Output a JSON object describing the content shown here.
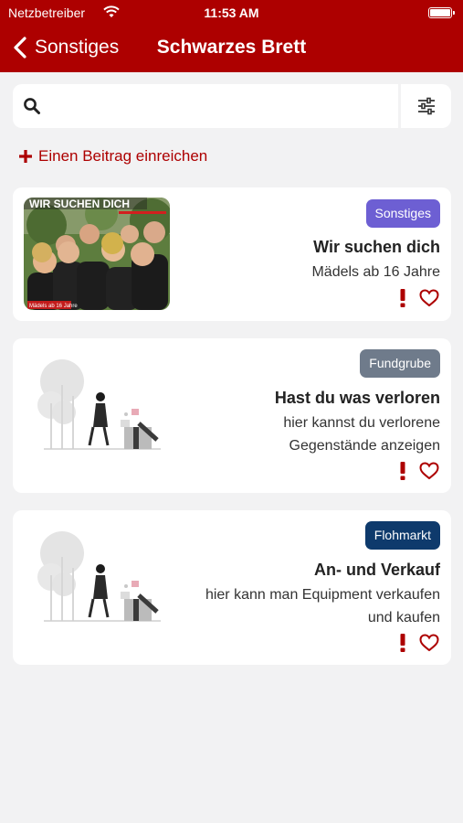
{
  "status_bar": {
    "carrier": "Netzbetreiber",
    "time": "11:53 AM"
  },
  "nav": {
    "back_label": "Sonstiges",
    "title": "Schwarzes Brett"
  },
  "search": {
    "placeholder": "",
    "value": ""
  },
  "add_post_label": "Einen Beitrag einreichen",
  "theme": {
    "brand": "#ad0000",
    "background": "#f2f2f3"
  },
  "cards": [
    {
      "badge": "Sonstiges",
      "badge_color": "#6d5fd3",
      "title": "Wir suchen dich",
      "subtitle": [
        "Mädels ab 16 Jahre"
      ],
      "image": "group-photo",
      "image_text": "WIR SUCHEN DICH",
      "image_caption": "Mädels ab 16 Jahre"
    },
    {
      "badge": "Fundgrube",
      "badge_color": "#6f7b8b",
      "title": "Hast du was verloren",
      "subtitle": [
        "hier kannst du verlorene",
        "Gegenstände anzeigen"
      ],
      "image": "lost-and-found-illustration"
    },
    {
      "badge": "Flohmarkt",
      "badge_color": "#0e3a6c",
      "title": "An- und Verkauf",
      "subtitle": [
        "hier kann man Equipment verkaufen",
        "und kaufen"
      ],
      "image": "lost-and-found-illustration"
    }
  ]
}
